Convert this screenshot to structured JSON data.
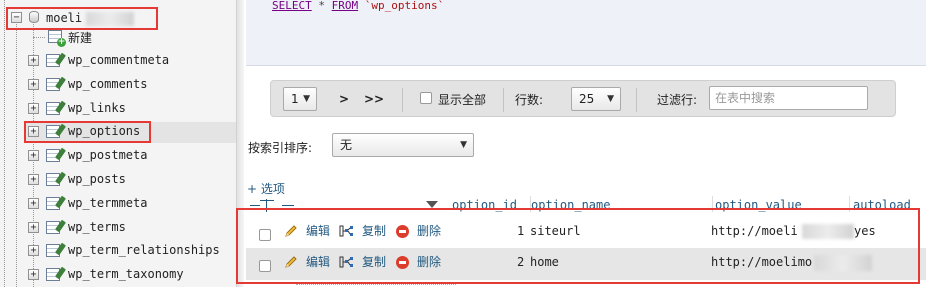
{
  "sidebar": {
    "database": {
      "label": "moeli",
      "expander": "−"
    },
    "new_item": {
      "label": "新建"
    },
    "tables": [
      {
        "label": "wp_commentmeta",
        "expander": "+"
      },
      {
        "label": "wp_comments",
        "expander": "+"
      },
      {
        "label": "wp_links",
        "expander": "+"
      },
      {
        "label": "wp_options",
        "expander": "+"
      },
      {
        "label": "wp_postmeta",
        "expander": "+"
      },
      {
        "label": "wp_posts",
        "expander": "+"
      },
      {
        "label": "wp_termmeta",
        "expander": "+"
      },
      {
        "label": "wp_terms",
        "expander": "+"
      },
      {
        "label": "wp_term_relationships",
        "expander": "+"
      },
      {
        "label": "wp_term_taxonomy",
        "expander": "+"
      }
    ],
    "selected_table": "wp_options"
  },
  "sql": {
    "keyword_select": "SELECT",
    "star": " * ",
    "keyword_from": "FROM",
    "table": " `wp_options`"
  },
  "navigation": {
    "page_value": "1",
    "next_label": ">",
    "last_label": ">>",
    "show_all_label": "显示全部",
    "rows_label": "行数:",
    "rows_value": "25",
    "filter_label": "过滤行:",
    "filter_placeholder": "在表中搜索"
  },
  "sort": {
    "label": "按索引排序:",
    "value": "无"
  },
  "options_link": "+ 选项",
  "columns": {
    "headers": [
      "option_id",
      "option_name",
      "option_value",
      "autoload"
    ]
  },
  "rows": [
    {
      "edit_label": "编辑",
      "copy_label": "复制",
      "delete_label": "删除",
      "option_id": "1",
      "option_name": "siteurl",
      "option_value": "http://moeli",
      "autoload": "yes"
    },
    {
      "edit_label": "编辑",
      "copy_label": "复制",
      "delete_label": "删除",
      "option_id": "2",
      "option_name": "home",
      "option_value": "http://moelimo",
      "autoload": ""
    }
  ],
  "colors": {
    "highlight": "#e53935",
    "link": "#235a81",
    "sql_keyword": "#770088",
    "sql_string": "#aa1111"
  },
  "icons": {
    "expand": "plus-box-icon",
    "collapse": "minus-box-icon",
    "database": "database-icon",
    "table": "table-icon",
    "new": "new-table-icon",
    "edit": "pencil-icon",
    "copy": "copy-icon",
    "delete": "delete-icon"
  }
}
